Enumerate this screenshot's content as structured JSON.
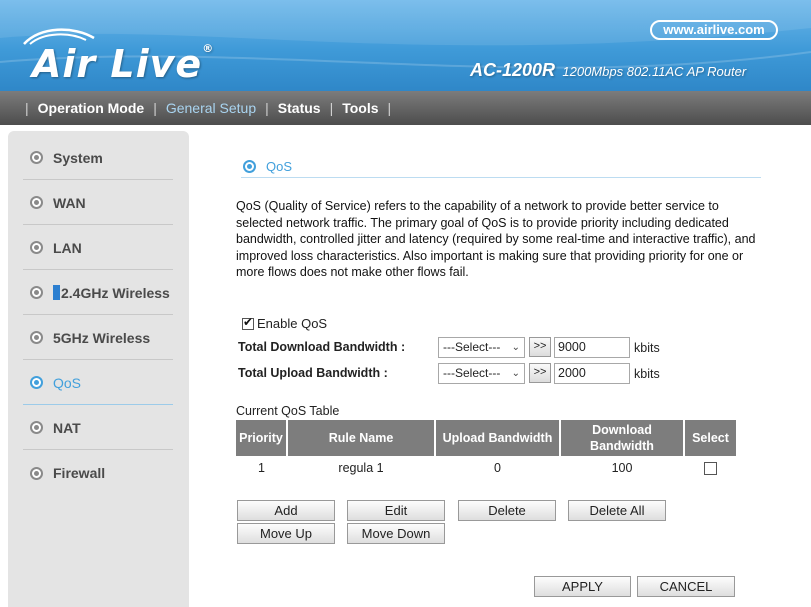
{
  "header": {
    "logo_text": "Air Live",
    "logo_reg": "®",
    "url": "www.airlive.com",
    "model_name": "AC-1200R",
    "model_desc": "1200Mbps 802.11AC AP Router"
  },
  "nav": {
    "items": [
      {
        "label": "Operation Mode"
      },
      {
        "label": "General Setup"
      },
      {
        "label": "Status"
      },
      {
        "label": "Tools"
      }
    ],
    "active": "General Setup",
    "separator": "|"
  },
  "sidebar": {
    "items": [
      {
        "label": "System"
      },
      {
        "label": "WAN"
      },
      {
        "label": "LAN"
      },
      {
        "label": "2.4GHz Wireless"
      },
      {
        "label": "5GHz Wireless"
      },
      {
        "label": "QoS"
      },
      {
        "label": "NAT"
      },
      {
        "label": "Firewall"
      }
    ],
    "active": "QoS"
  },
  "main": {
    "title": "QoS",
    "description": "QoS (Quality of Service) refers to the capability of a network to provide better service to selected network traffic. The primary goal of QoS is to provide priority including dedicated bandwidth, controlled jitter and latency (required by some real-time and interactive traffic), and improved loss characteristics. Also important is making sure that providing priority for one or more flows does not make other flows fail.",
    "enable_label": "Enable QoS",
    "enable_checked": true,
    "download": {
      "label": "Total Download Bandwidth :",
      "select_value": "---Select---",
      "arrow_label": ">>",
      "value": "9000",
      "unit": "kbits"
    },
    "upload": {
      "label": "Total Upload Bandwidth :",
      "select_value": "---Select---",
      "arrow_label": ">>",
      "value": "2000",
      "unit": "kbits"
    },
    "table_caption": "Current QoS Table",
    "table": {
      "headers": [
        "Priority",
        "Rule Name",
        "Upload Bandwidth",
        "Download Bandwidth",
        "Select"
      ],
      "rows": [
        {
          "priority": "1",
          "rule_name": "regula 1",
          "upload": "0",
          "download": "100",
          "selected": false
        }
      ]
    },
    "buttons": {
      "add": "Add",
      "edit": "Edit",
      "delete": "Delete",
      "delete_all": "Delete All",
      "move_up": "Move Up",
      "move_down": "Move Down",
      "apply": "APPLY",
      "cancel": "CANCEL"
    }
  }
}
